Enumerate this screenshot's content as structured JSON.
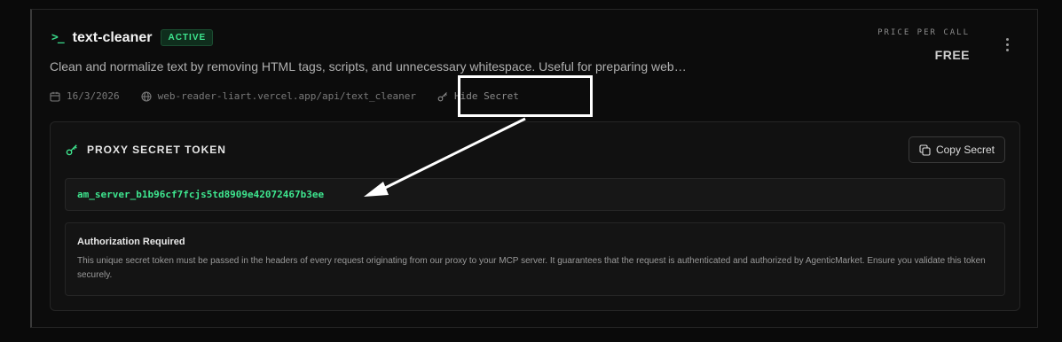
{
  "tool": {
    "prompt_glyph": ">_",
    "name": "text-cleaner",
    "status": "ACTIVE",
    "description": "Clean and normalize text by removing HTML tags, scripts, and unnecessary whitespace. Useful for preparing web…",
    "date": "16/3/2026",
    "url": "web-reader-liart.vercel.app/api/text_cleaner",
    "hide_secret_label": "Hide Secret"
  },
  "pricing": {
    "label": "PRICE PER CALL",
    "value": "FREE"
  },
  "secret_panel": {
    "title": "PROXY SECRET TOKEN",
    "copy_label": "Copy Secret",
    "token": "am_server_b1b96cf7fcjs5td8909e42072467b3ee",
    "auth_title": "Authorization Required",
    "auth_text": "This unique secret token must be passed in the headers of every request originating from our proxy to your MCP server. It guarantees that the request is authenticated and authorized by AgenticMarket. Ensure you validate this token securely."
  },
  "colors": {
    "accent_green": "#3ee68f",
    "annotation": "#ffffff"
  },
  "icons": [
    "terminal-icon",
    "calendar-icon",
    "globe-icon",
    "key-icon",
    "copy-icon",
    "more-vertical-icon"
  ]
}
